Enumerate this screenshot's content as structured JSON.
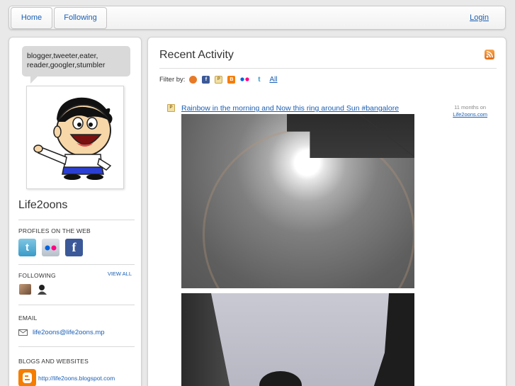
{
  "nav": {
    "home_label": "Home",
    "following_label": "Following",
    "login_label": "Login"
  },
  "sidebar": {
    "bio_line1": "blogger,tweeter,eater,",
    "bio_line2": "reader,googler,stumbler",
    "profile_name": "Life2oons",
    "profiles_title": "PROFILES ON THE WEB",
    "profiles": [
      {
        "icon": "twitter-icon",
        "glyph": "t"
      },
      {
        "icon": "flickr-icon",
        "glyph": ""
      },
      {
        "icon": "facebook-icon",
        "glyph": "f"
      }
    ],
    "following_title": "FOLLOWING",
    "view_all_label": "VIEW ALL",
    "email_title": "EMAIL",
    "email": "life2oons@life2oons.mp",
    "blogs_title": "BLOGS AND WEBSITES",
    "blog_url": "http://life2oons.blogspot.com"
  },
  "main": {
    "title": "Recent Activity",
    "filter_label": "Filter by:",
    "filter_all_label": "All",
    "post": {
      "title": "Rainbow in the morning and Now this ring around Sun #bangalore",
      "time": "11 months on",
      "source": "Life2oons.com",
      "source_icon_glyph": "P"
    }
  },
  "colors": {
    "link": "#1a5fb4",
    "background": "#e9e9e9",
    "rss": "#e36a12",
    "blogger": "#f57d00",
    "facebook": "#3b5998"
  }
}
